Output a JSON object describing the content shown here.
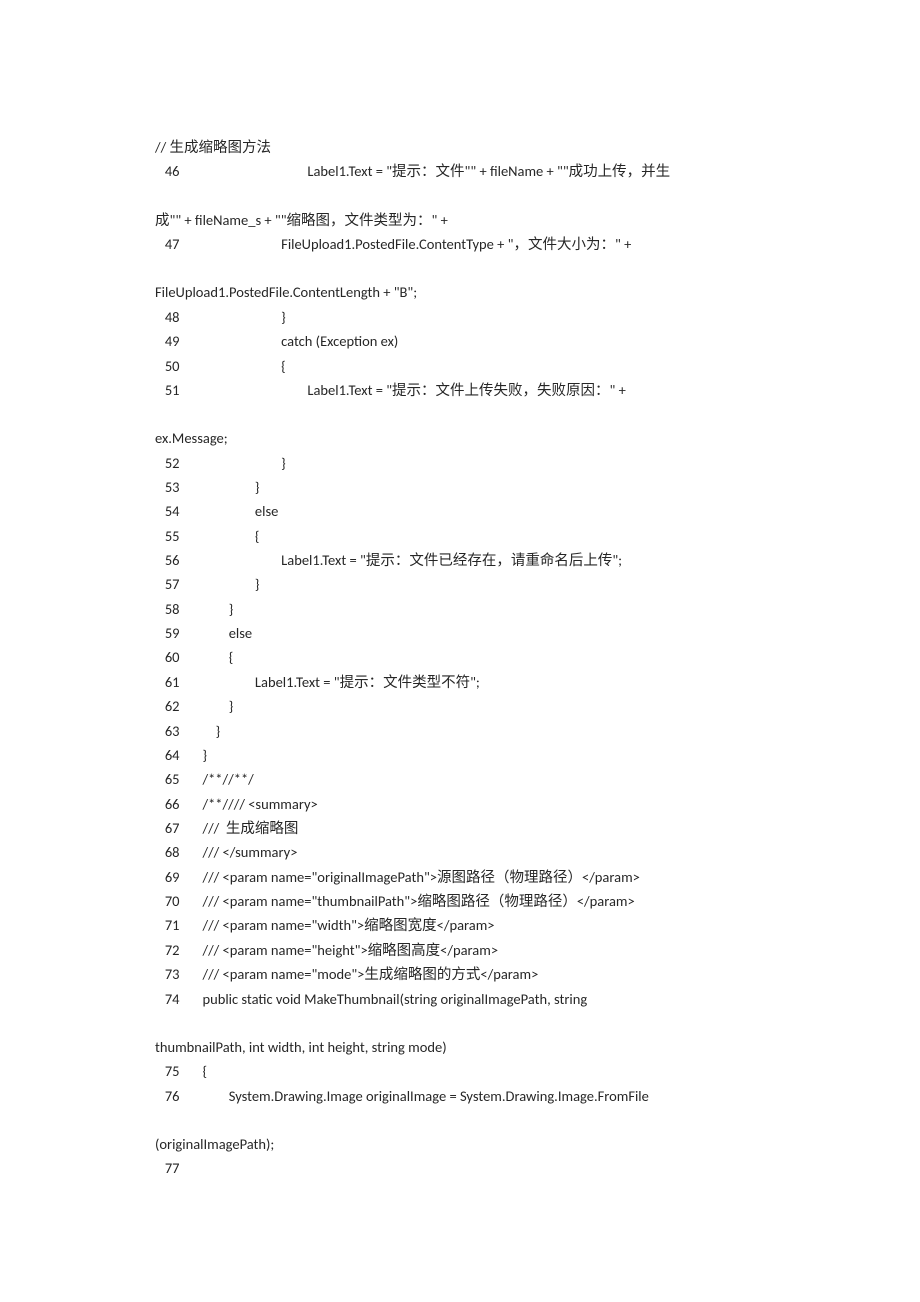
{
  "title": "// 生成缩略图方法",
  "lines": [
    {
      "n": "46",
      "indent": 36,
      "t": "Label1.Text = \"提示：文件\"\" + fileName + \"\"成功上传，并生"
    },
    {
      "wrap": true,
      "t": "成\"\" + fileName_s + \"\"缩略图，文件类型为：\" +"
    },
    {
      "n": "47",
      "indent": 28,
      "t": "FileUpload1.PostedFile.ContentType + \"，文件大小为：\" +"
    },
    {
      "wrap": true,
      "t": "FileUpload1.PostedFile.ContentLength + \"B\";"
    },
    {
      "n": "48",
      "indent": 28,
      "t": "}"
    },
    {
      "n": "49",
      "indent": 28,
      "t": "catch (Exception ex)"
    },
    {
      "n": "50",
      "indent": 28,
      "t": "{"
    },
    {
      "n": "51",
      "indent": 36,
      "t": "Label1.Text = \"提示：文件上传失败，失败原因：\" +"
    },
    {
      "wrap": true,
      "t": "ex.Message;"
    },
    {
      "n": "52",
      "indent": 28,
      "t": "}"
    },
    {
      "n": "53",
      "indent": 20,
      "t": "}"
    },
    {
      "n": "54",
      "indent": 20,
      "t": "else"
    },
    {
      "n": "55",
      "indent": 20,
      "t": "{"
    },
    {
      "n": "56",
      "indent": 28,
      "t": "Label1.Text = \"提示：文件已经存在，请重命名后上传\";"
    },
    {
      "n": "57",
      "indent": 20,
      "t": "}"
    },
    {
      "n": "58",
      "indent": 12,
      "t": "}"
    },
    {
      "n": "59",
      "indent": 12,
      "t": "else"
    },
    {
      "n": "60",
      "indent": 12,
      "t": "{"
    },
    {
      "n": "61",
      "indent": 20,
      "t": "Label1.Text = \"提示：文件类型不符\";"
    },
    {
      "n": "62",
      "indent": 12,
      "t": "}"
    },
    {
      "n": "63",
      "indent": 8,
      "t": "}"
    },
    {
      "n": "64",
      "indent": 4,
      "t": "}"
    },
    {
      "n": "65",
      "indent": 4,
      "t": "/**//**/"
    },
    {
      "n": "66",
      "indent": 4,
      "t": "/**//// <summary>"
    },
    {
      "n": "67",
      "indent": 4,
      "t": "///  生成缩略图"
    },
    {
      "n": "68",
      "indent": 4,
      "t": "/// </summary>"
    },
    {
      "n": "69",
      "indent": 4,
      "t": "/// <param name=\"originalImagePath\">源图路径（物理路径）</param>"
    },
    {
      "n": "70",
      "indent": 4,
      "t": "/// <param name=\"thumbnailPath\">缩略图路径（物理路径）</param>"
    },
    {
      "n": "71",
      "indent": 4,
      "t": "/// <param name=\"width\">缩略图宽度</param>"
    },
    {
      "n": "72",
      "indent": 4,
      "t": "/// <param name=\"height\">缩略图高度</param>"
    },
    {
      "n": "73",
      "indent": 4,
      "t": "/// <param name=\"mode\">生成缩略图的方式</param>"
    },
    {
      "n": "74",
      "indent": 4,
      "t": "public static void MakeThumbnail(string originalImagePath, string"
    },
    {
      "wrap": true,
      "t": "thumbnailPath, int width, int height, string mode)"
    },
    {
      "n": "75",
      "indent": 4,
      "t": "{"
    },
    {
      "n": "76",
      "indent": 12,
      "t": "System.Drawing.Image originalImage = System.Drawing.Image.FromFile"
    },
    {
      "wrap": true,
      "t": "(originalImagePath);"
    },
    {
      "n": "77",
      "indent": 4,
      "t": ""
    }
  ]
}
